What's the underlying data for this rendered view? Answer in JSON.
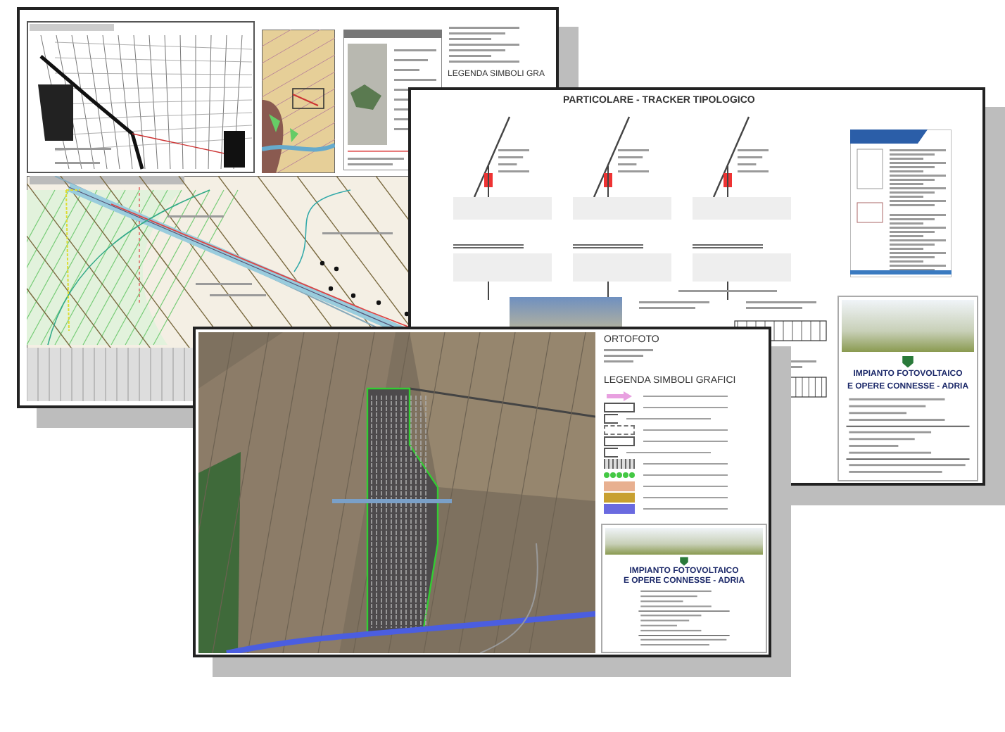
{
  "cadastral_sheet": {
    "legend_title": "LEGENDA SIMBOLI GRA"
  },
  "tracker_sheet": {
    "title": "PARTICOLARE - TRACKER TIPOLOGICO",
    "title_block": {
      "project_line_1": "IMPIANTO FOTOVOLTAICO",
      "project_line_2": "E OPERE CONNESSE - ADRIA"
    }
  },
  "ortho_sheet": {
    "title": "ORTOFOTO",
    "legend_title": "LEGENDA SIMBOLI GRAFICI",
    "legend": [
      {
        "kind": "arrow",
        "color": "#e8a0e0"
      },
      {
        "kind": "outline"
      },
      {
        "kind": "bracket"
      },
      {
        "kind": "dashed"
      },
      {
        "kind": "outline"
      },
      {
        "kind": "bracket"
      },
      {
        "kind": "hatch"
      },
      {
        "kind": "dots",
        "color": "#44c844"
      },
      {
        "kind": "swatch",
        "color": "#e8b090"
      },
      {
        "kind": "swatch",
        "color": "#c8a030"
      },
      {
        "kind": "swatch",
        "color": "#6a6ae0"
      }
    ],
    "title_block": {
      "project_line_1": "IMPIANTO FOTOVOLTAICO",
      "project_line_2": "E OPERE CONNESSE - ADRIA"
    }
  }
}
